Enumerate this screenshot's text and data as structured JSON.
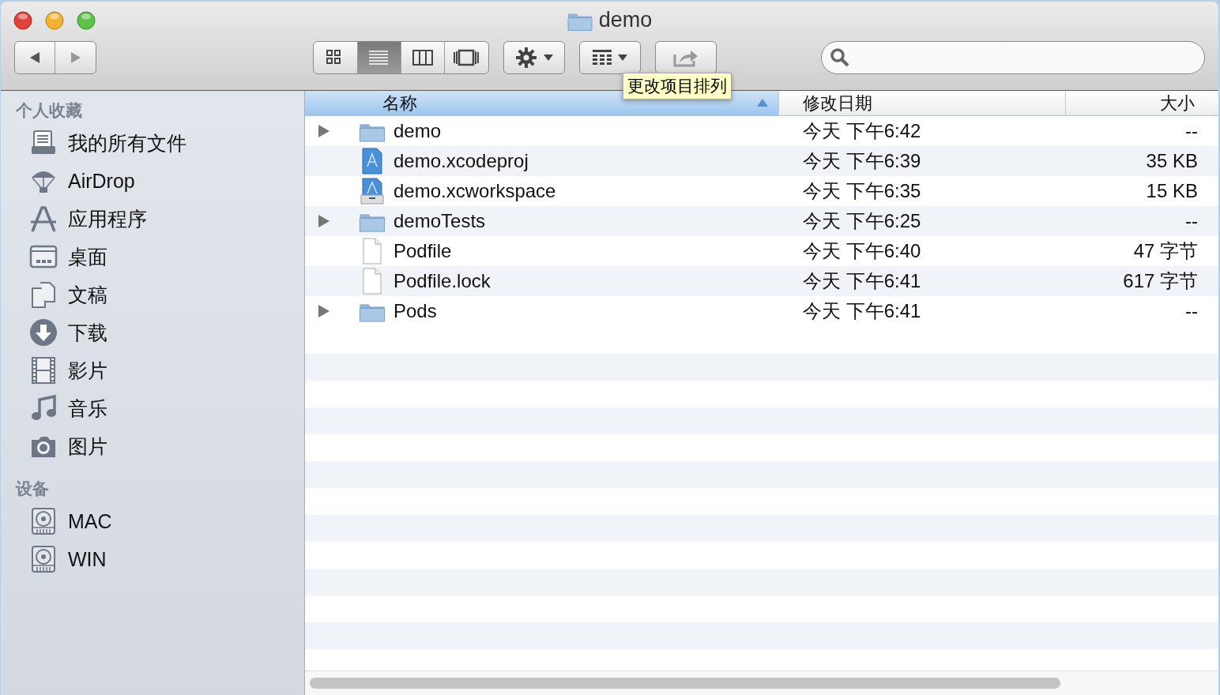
{
  "window": {
    "title": "demo"
  },
  "toolbar": {
    "view_modes": [
      {
        "kind": "icon",
        "selected": false
      },
      {
        "kind": "list",
        "selected": true
      },
      {
        "kind": "column",
        "selected": false
      },
      {
        "kind": "coverflow",
        "selected": false
      }
    ],
    "tooltip": "更改项目排列"
  },
  "sidebar": {
    "sections": [
      {
        "heading": "个人收藏",
        "items": [
          {
            "label": "我的所有文件",
            "kind": "allfiles"
          },
          {
            "label": "AirDrop",
            "kind": "airdrop"
          },
          {
            "label": "应用程序",
            "kind": "apps"
          },
          {
            "label": "桌面",
            "kind": "desktop"
          },
          {
            "label": "文稿",
            "kind": "documents"
          },
          {
            "label": "下载",
            "kind": "downloads"
          },
          {
            "label": "影片",
            "kind": "movies"
          },
          {
            "label": "音乐",
            "kind": "music"
          },
          {
            "label": "图片",
            "kind": "pictures"
          }
        ]
      },
      {
        "heading": "设备",
        "items": [
          {
            "label": "MAC",
            "kind": "disk"
          },
          {
            "label": "WIN",
            "kind": "disk"
          }
        ]
      }
    ]
  },
  "table": {
    "columns": [
      {
        "label": "名称",
        "selected": true,
        "sorted": true
      },
      {
        "label": "修改日期",
        "selected": false,
        "sorted": false
      },
      {
        "label": "大小",
        "selected": false,
        "sorted": false
      }
    ],
    "rows": [
      {
        "kind": "folder",
        "name": "demo",
        "date": "今天 下午6:42",
        "size": "--"
      },
      {
        "kind": "xcodeproj",
        "name": "demo.xcodeproj",
        "date": "今天 下午6:39",
        "size": "35 KB"
      },
      {
        "kind": "xcworkspace",
        "name": "demo.xcworkspace",
        "date": "今天 下午6:35",
        "size": "15 KB"
      },
      {
        "kind": "folder",
        "name": "demoTests",
        "date": "今天 下午6:25",
        "size": "--"
      },
      {
        "kind": "file",
        "name": "Podfile",
        "date": "今天 下午6:40",
        "size": "47 字节"
      },
      {
        "kind": "file",
        "name": "Podfile.lock",
        "date": "今天 下午6:41",
        "size": "617 字节"
      },
      {
        "kind": "folder",
        "name": "Pods",
        "date": "今天 下午6:41",
        "size": "--"
      }
    ]
  }
}
